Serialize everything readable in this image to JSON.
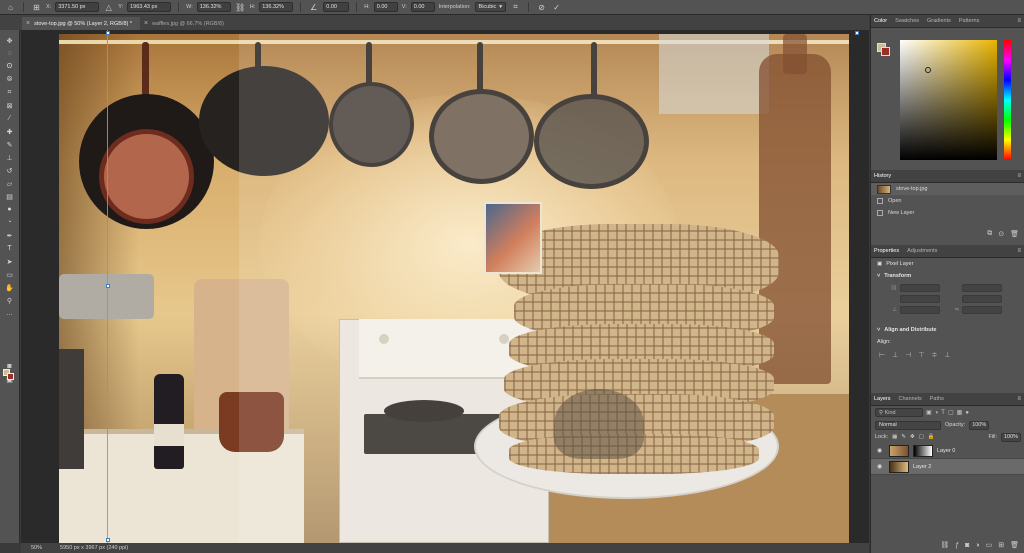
{
  "options_bar": {
    "x_label": "X:",
    "x_value": "3371.50 px",
    "y_label": "Y:",
    "y_value": "1963.43 px",
    "w_label": "W:",
    "w_value": "136.32%",
    "h_label": "H:",
    "h_value": "136.32%",
    "angle_value": "0.00",
    "hskew_label": "H:",
    "hskew_value": "0.00",
    "vskew_label": "V:",
    "vskew_value": "0.00",
    "interpolation_label": "Interpolation:",
    "interpolation_value": "Bicubic"
  },
  "tabs": [
    {
      "label": "stove-top.jpg @ 50% (Layer 2, RGB/8) *",
      "active": true
    },
    {
      "label": "waffles.jpg @ 66.7% (RGB/8)",
      "active": false
    }
  ],
  "colors": {
    "foreground": "#c9bd9b",
    "background": "#9a2f25",
    "accent": "#5fa0e6"
  },
  "color_panel": {
    "tabs": [
      "Color",
      "Swatches",
      "Gradients",
      "Patterns"
    ]
  },
  "history_panel": {
    "title": "History",
    "snapshot": "stove-top.jpg",
    "items": [
      "Open",
      "New Layer"
    ]
  },
  "properties_panel": {
    "tabs": [
      "Properties",
      "Adjustments"
    ],
    "layer_type": "Pixel Layer",
    "transform_label": "Transform",
    "align_label": "Align and Distribute",
    "align_sub": "Align:"
  },
  "layers_panel": {
    "tabs": [
      "Layers",
      "Channels",
      "Paths"
    ],
    "kind_placeholder": "Kind",
    "blend_mode": "Normal",
    "opacity_label": "Opacity:",
    "opacity_value": "100%",
    "lock_label": "Lock:",
    "fill_label": "Fill:",
    "fill_value": "100%",
    "layers": [
      {
        "name": "Layer 0",
        "selected": false
      },
      {
        "name": "Layer 2",
        "selected": true
      }
    ]
  },
  "status_bar": {
    "zoom": "50%",
    "doc_info": "5950 px x 3967 px (240 ppi)"
  }
}
